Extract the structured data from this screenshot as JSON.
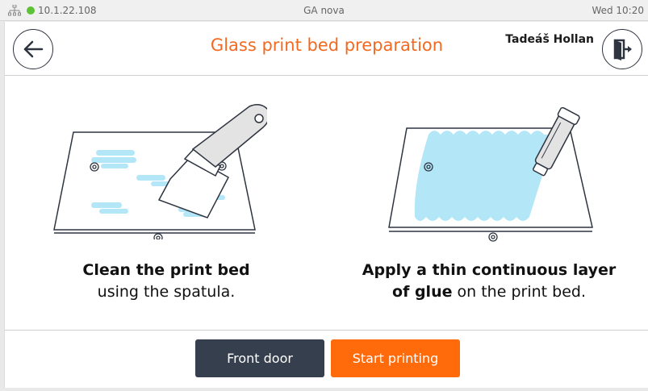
{
  "statusbar": {
    "ip": "10.1.22.108",
    "device_name": "GA nova",
    "clock": "Wed 10:20",
    "network_icon": "network-icon",
    "status_color": "#5cc236"
  },
  "header": {
    "title": "Glass print bed preparation",
    "username": "Tadeáš Hollan",
    "title_color": "#f26a22",
    "back_icon": "arrow-left-icon",
    "logout_icon": "logout-icon"
  },
  "steps": [
    {
      "bold": "Clean the print bed",
      "text": "using the spatula.",
      "illustration": "spatula-cleaning-bed"
    },
    {
      "bold_line1": "Apply a thin continuous layer",
      "bold_line2": "of glue",
      "text": " on the print bed.",
      "illustration": "glue-stick-on-bed"
    }
  ],
  "buttons": {
    "front_door": "Front door",
    "start_printing": "Start printing",
    "front_door_color": "#363f4e",
    "start_color": "#ff6a0a"
  },
  "colors": {
    "glue": "#b3e6f7",
    "line": "#2e3440"
  }
}
